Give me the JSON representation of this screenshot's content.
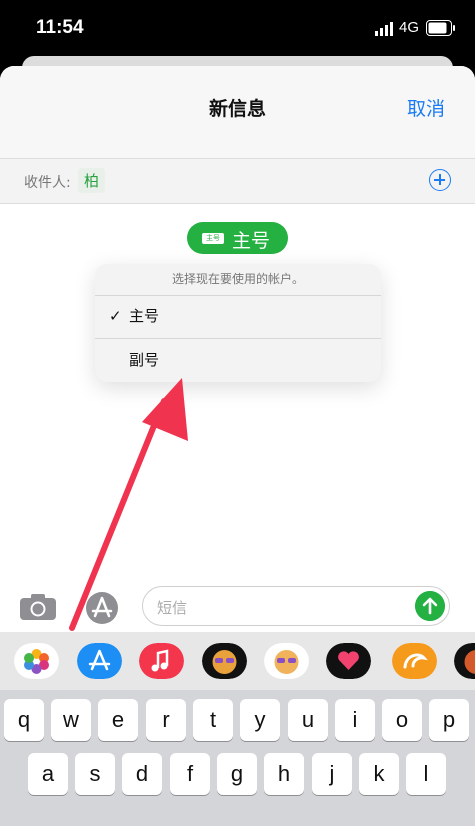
{
  "status": {
    "time": "11:54",
    "network": "4G"
  },
  "header": {
    "title": "新信息",
    "cancel": "取消"
  },
  "recipient": {
    "label": "收件人:",
    "chip": "柏"
  },
  "account_pill": {
    "sim_text": "主号",
    "label": "主号"
  },
  "popover": {
    "hint": "选择现在要使用的帐户。",
    "items": [
      {
        "label": "主号",
        "checked": true,
        "check": "✓"
      },
      {
        "label": "副号",
        "checked": false
      }
    ]
  },
  "composer": {
    "placeholder": "短信"
  },
  "app_strip": {
    "icons": [
      "photos-icon",
      "app-store-icon",
      "music-icon",
      "memoji-icon",
      "memoji-stickers-icon",
      "digital-touch-icon",
      "uc-browser-icon",
      "memoji-partial-icon"
    ]
  },
  "keyboard": {
    "row1": [
      "q",
      "w",
      "e",
      "r",
      "t",
      "y",
      "u",
      "i",
      "o",
      "p"
    ],
    "row2": [
      "a",
      "s",
      "d",
      "f",
      "g",
      "h",
      "j",
      "k",
      "l"
    ]
  },
  "colors": {
    "accent": "#1a7cf5",
    "green": "#25b042",
    "arrow": "#f0334f"
  }
}
